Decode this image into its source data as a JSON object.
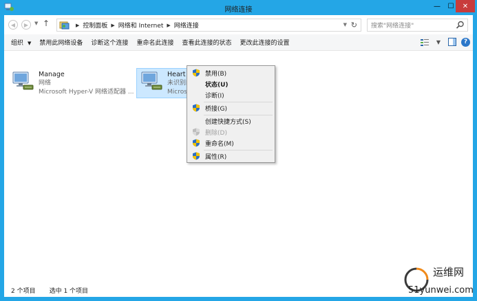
{
  "window": {
    "title": "网络连接",
    "buttons": {
      "minimize": "—",
      "maximize": "☐",
      "close": "✕"
    }
  },
  "colors": {
    "frame": "#24a6e6",
    "selection": "#cce8ff",
    "close": "#c83c3c"
  },
  "address": {
    "crumbs": [
      "控制面板",
      "网络和 Internet",
      "网络连接"
    ],
    "search_placeholder": "搜索\"网络连接\""
  },
  "commands": {
    "organize": "组织",
    "items": [
      "禁用此网络设备",
      "诊断这个连接",
      "重命名此连接",
      "查看此连接的状态",
      "更改此连接的设置"
    ]
  },
  "connections": [
    {
      "name": "Manage",
      "status": "网络",
      "adapter": "Microsoft Hyper-V 网络适配器 ..."
    },
    {
      "name": "Heart",
      "status": "未识别的网络",
      "adapter": "Microsoft Hyper-V 网络适配器"
    }
  ],
  "context_menu": {
    "items": [
      {
        "label": "禁用(B)",
        "icon": "shield-icon"
      },
      {
        "label": "状态(U)",
        "bold": true
      },
      {
        "label": "诊断(I)"
      },
      {
        "label": "桥接(G)",
        "icon": "shield-icon"
      },
      {
        "label": "创建快捷方式(S)"
      },
      {
        "label": "删除(D)",
        "icon": "shield-icon",
        "disabled": true
      },
      {
        "label": "重命名(M)",
        "icon": "shield-icon"
      },
      {
        "label": "属性(R)",
        "icon": "shield-icon"
      }
    ]
  },
  "status": {
    "count": "2 个项目",
    "selected": "选中 1 个项目"
  },
  "watermark": {
    "line1": "运维网",
    "line2": "51yunwei.com"
  }
}
